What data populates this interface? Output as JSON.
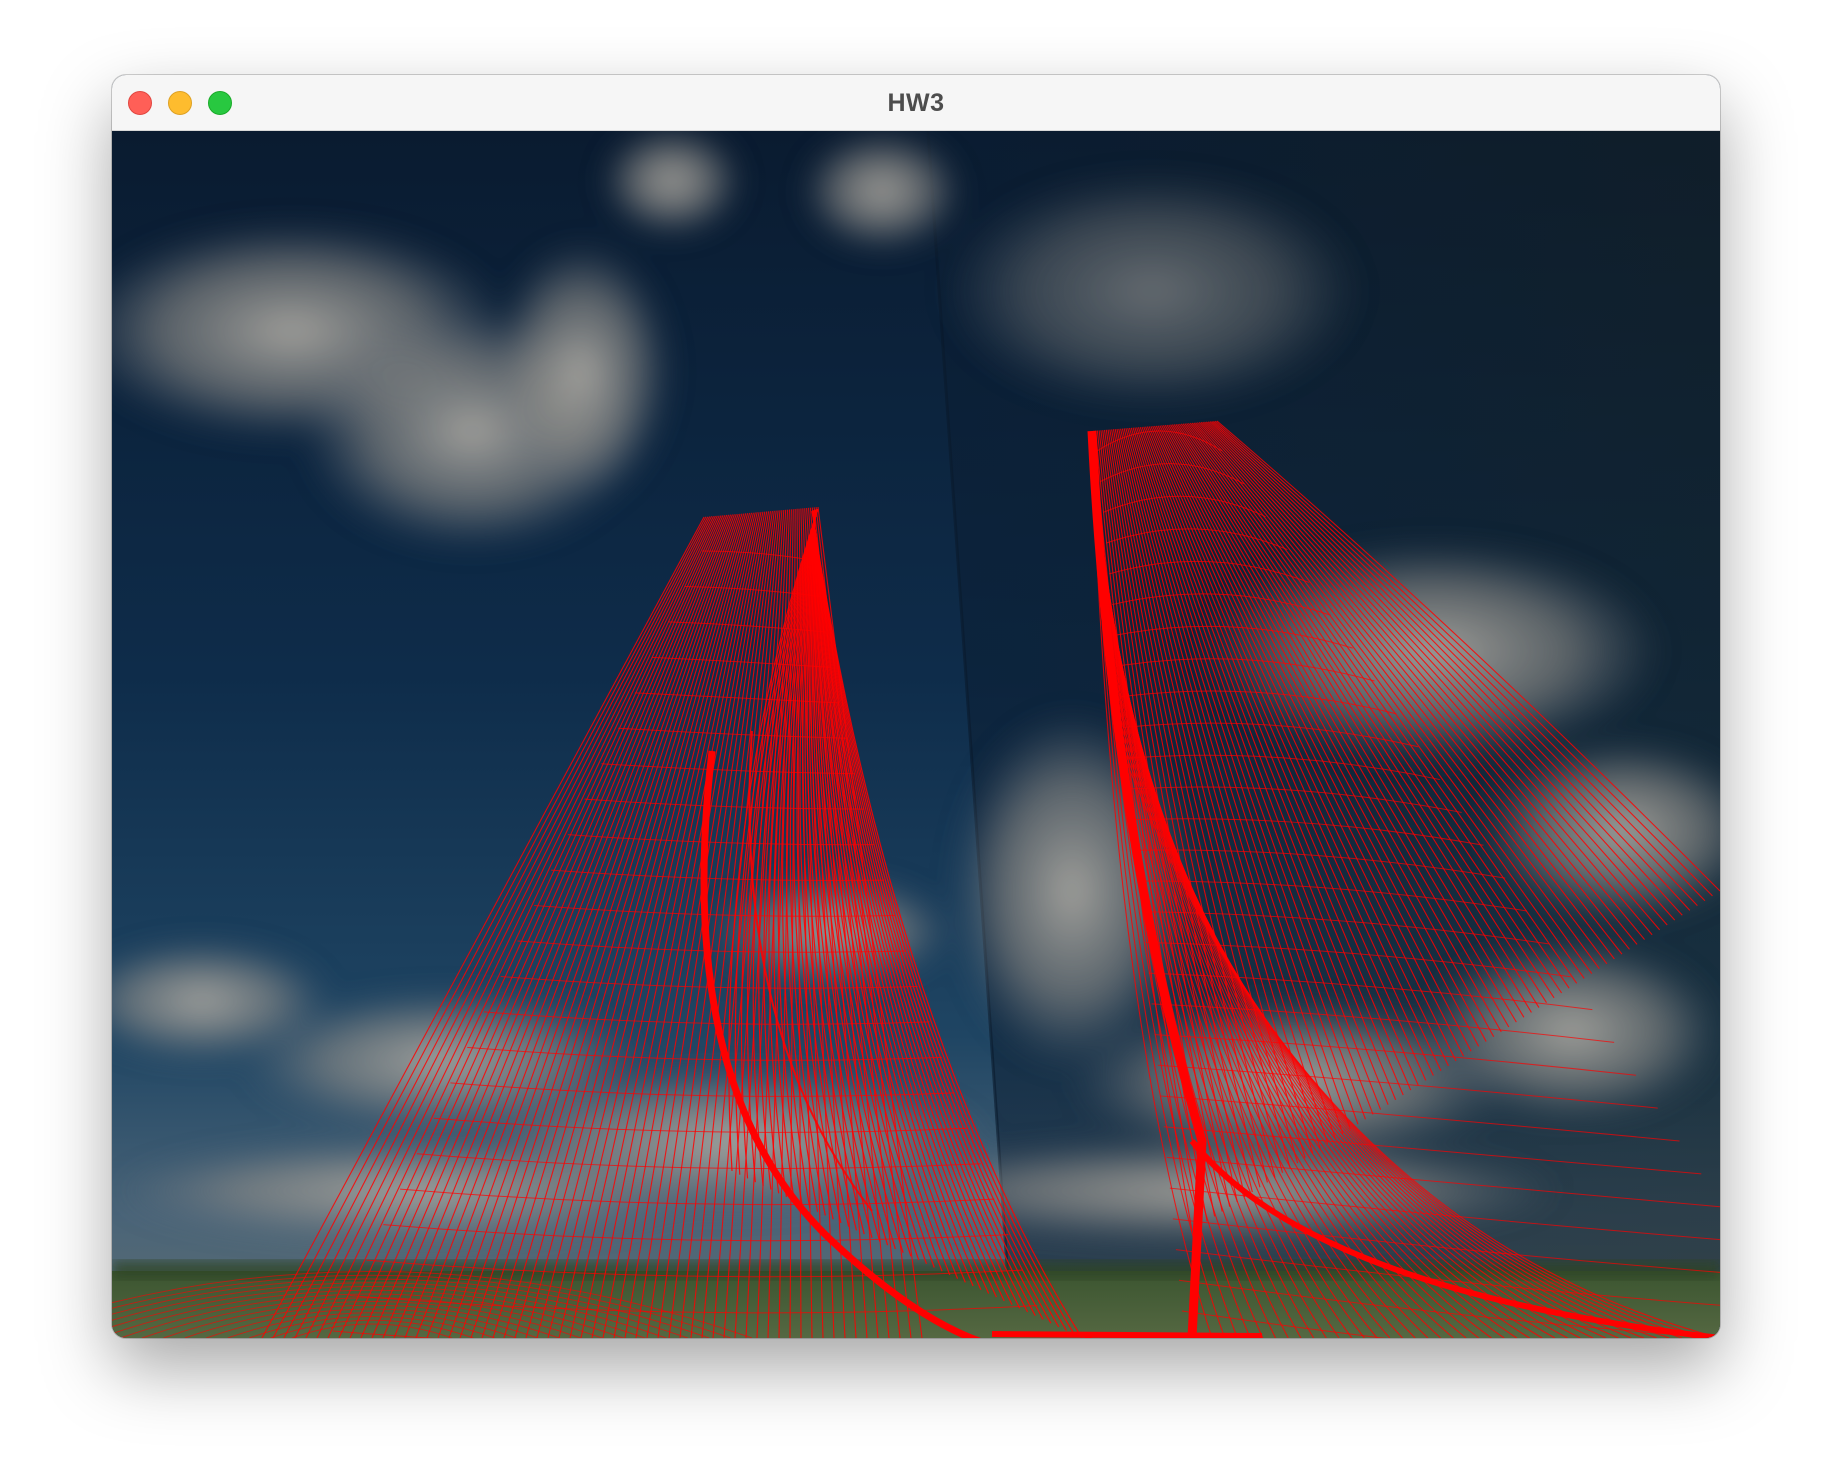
{
  "window": {
    "title": "HW3"
  },
  "controls": {
    "close": "close-window",
    "minimize": "minimize-window",
    "maximize": "maximize-window"
  },
  "scene": {
    "wireframe_color": "#ff0000",
    "sky_top_color": "#0b1f35",
    "sky_horizon_color": "#3d5a72",
    "ground_color": "#3f5a38",
    "cloud_color": "#a9a6a0"
  }
}
